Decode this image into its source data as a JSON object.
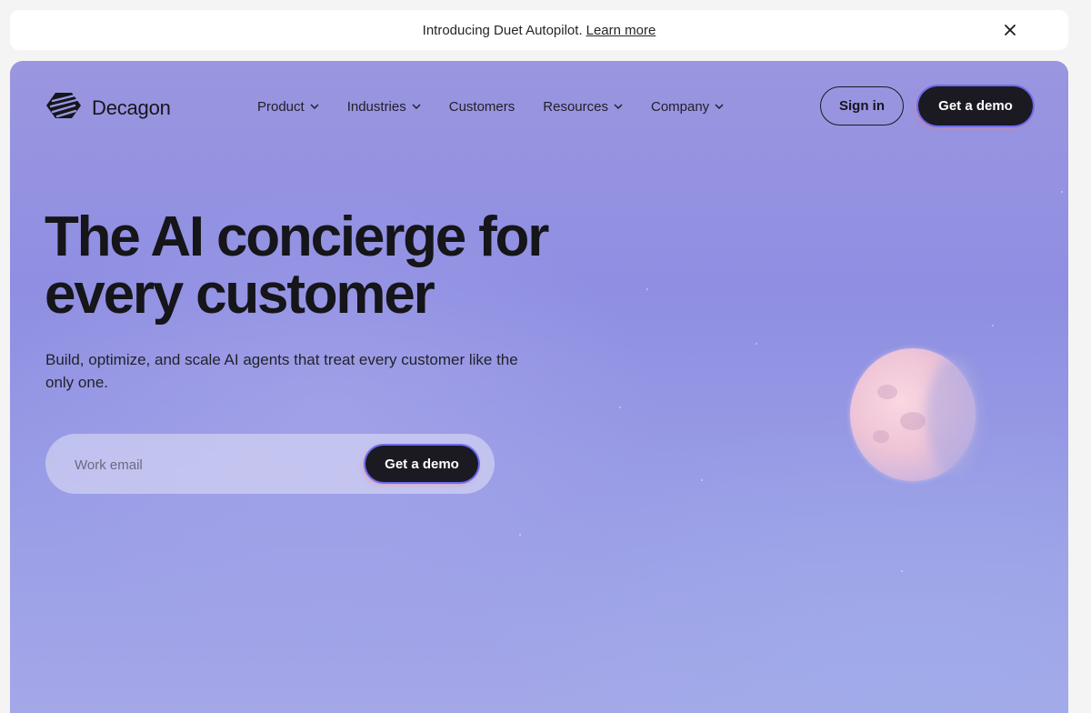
{
  "announcement": {
    "text": "Introducing Duet Autopilot.",
    "link_label": "Learn more",
    "close_icon": "close-icon"
  },
  "nav": {
    "brand": "Decagon",
    "logo_icon": "decagon-logo-icon",
    "menu": [
      {
        "label": "Product",
        "has_dropdown": true
      },
      {
        "label": "Industries",
        "has_dropdown": true
      },
      {
        "label": "Customers",
        "has_dropdown": false
      },
      {
        "label": "Resources",
        "has_dropdown": true
      },
      {
        "label": "Company",
        "has_dropdown": true
      }
    ],
    "signin_label": "Sign in",
    "demo_label": "Get a demo"
  },
  "hero": {
    "headline": "The AI concierge for every customer",
    "subtext": "Build, optimize, and scale AI agents that treat every customer like the only one.",
    "email_placeholder": "Work email",
    "cta_label": "Get a demo"
  },
  "colors": {
    "hero_bg": "#9a96e0",
    "button_dark": "#1b1a22",
    "button_ring": "#6d6cf0",
    "moon": "#eec4d6"
  }
}
